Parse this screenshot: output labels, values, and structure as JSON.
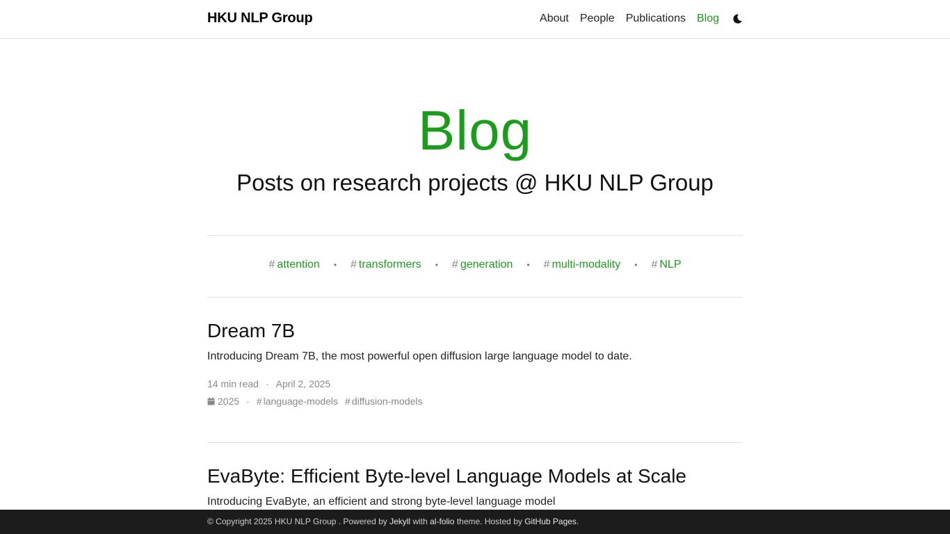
{
  "nav": {
    "brand": "HKU NLP Group",
    "links": [
      {
        "label": "About"
      },
      {
        "label": "People"
      },
      {
        "label": "Publications"
      },
      {
        "label": "Blog",
        "active": true
      }
    ],
    "theme_toggle_icon": "moon-icon"
  },
  "header": {
    "title": "Blog",
    "subtitle": "Posts on research projects @ HKU NLP Group"
  },
  "tags": [
    "attention",
    "transformers",
    "generation",
    "multi-modality",
    "NLP"
  ],
  "tag_separator": "•",
  "posts": [
    {
      "title": "Dream 7B",
      "description": "Introducing Dream 7B, the most powerful open diffusion large language model to date.",
      "read_time": "14 min read",
      "date": "April 2, 2025",
      "year": "2025",
      "tags": [
        "language-models",
        "diffusion-models"
      ]
    },
    {
      "title": "EvaByte: Efficient Byte-level Language Models at Scale",
      "description": "Introducing EvaByte, an efficient and strong byte-level language model"
    }
  ],
  "footer": {
    "prefix": "© Copyright 2025 HKU NLP Group . Powered by ",
    "jekyll": "Jekyll",
    "with": " with ",
    "theme": "al-folio",
    "theme_suffix": " theme. Hosted by ",
    "host": "GitHub Pages",
    "end": "."
  },
  "colors": {
    "accent": "#1a9d1a",
    "footer_bg": "#1c1c1c"
  }
}
